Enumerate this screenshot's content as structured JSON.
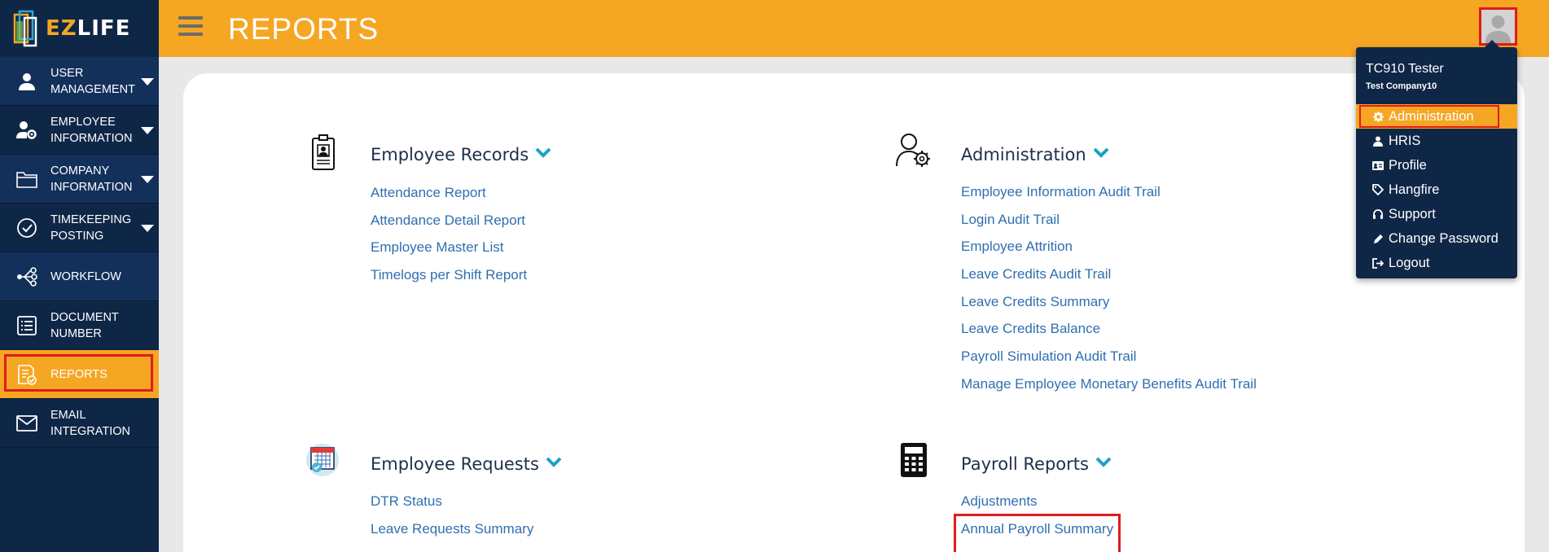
{
  "brand": {
    "ez": "EZ",
    "life": "LIFE"
  },
  "header": {
    "title": "REPORTS"
  },
  "sidebar": {
    "items": [
      {
        "label": "USER MANAGEMENT",
        "icon": "user-icon",
        "has_caret": true
      },
      {
        "label": "EMPLOYEE INFORMATION",
        "icon": "user-gear-icon",
        "has_caret": true
      },
      {
        "label": "COMPANY INFORMATION",
        "icon": "folder-icon",
        "has_caret": true
      },
      {
        "label": "TIMEKEEPING POSTING",
        "icon": "check-circle-icon",
        "has_caret": true
      },
      {
        "label": "WORKFLOW",
        "icon": "workflow-icon",
        "has_caret": false
      },
      {
        "label": "DOCUMENT NUMBER",
        "icon": "list-document-icon",
        "has_caret": false
      },
      {
        "label": "REPORTS",
        "icon": "report-icon",
        "has_caret": false,
        "active": true
      },
      {
        "label": "EMAIL INTEGRATION",
        "icon": "envelope-icon",
        "has_caret": false
      }
    ]
  },
  "sections": {
    "employee_records": {
      "title": "Employee Records",
      "links": [
        "Attendance Report",
        "Attendance Detail Report",
        "Employee Master List",
        "Timelogs per Shift Report"
      ]
    },
    "administration": {
      "title": "Administration",
      "links": [
        "Employee Information Audit Trail",
        "Login Audit Trail",
        "Employee Attrition",
        "Leave Credits Audit Trail",
        "Leave Credits Summary",
        "Leave Credits Balance",
        "Payroll Simulation Audit Trail",
        "Manage Employee Monetary Benefits Audit Trail"
      ]
    },
    "employee_requests": {
      "title": "Employee Requests",
      "links": [
        "DTR Status",
        "Leave Requests Summary"
      ]
    },
    "payroll_reports": {
      "title": "Payroll Reports",
      "links": [
        "Adjustments",
        "Annual Payroll Summary"
      ]
    }
  },
  "user_menu": {
    "user_name": "TC910 Tester",
    "company": "Test Company10",
    "items": [
      {
        "label": "Administration",
        "icon": "gear-icon",
        "active": true
      },
      {
        "label": "HRIS",
        "icon": "user-icon"
      },
      {
        "label": "Profile",
        "icon": "id-card-icon"
      },
      {
        "label": "Hangfire",
        "icon": "tags-icon"
      },
      {
        "label": "Support",
        "icon": "headset-icon"
      },
      {
        "label": "Change Password",
        "icon": "pencil-icon"
      },
      {
        "label": "Logout",
        "icon": "logout-icon"
      }
    ]
  },
  "colors": {
    "navy": "#0f2747",
    "accent": "#f5a623",
    "link": "#2f6fb0",
    "highlight": "#e01c1c"
  }
}
